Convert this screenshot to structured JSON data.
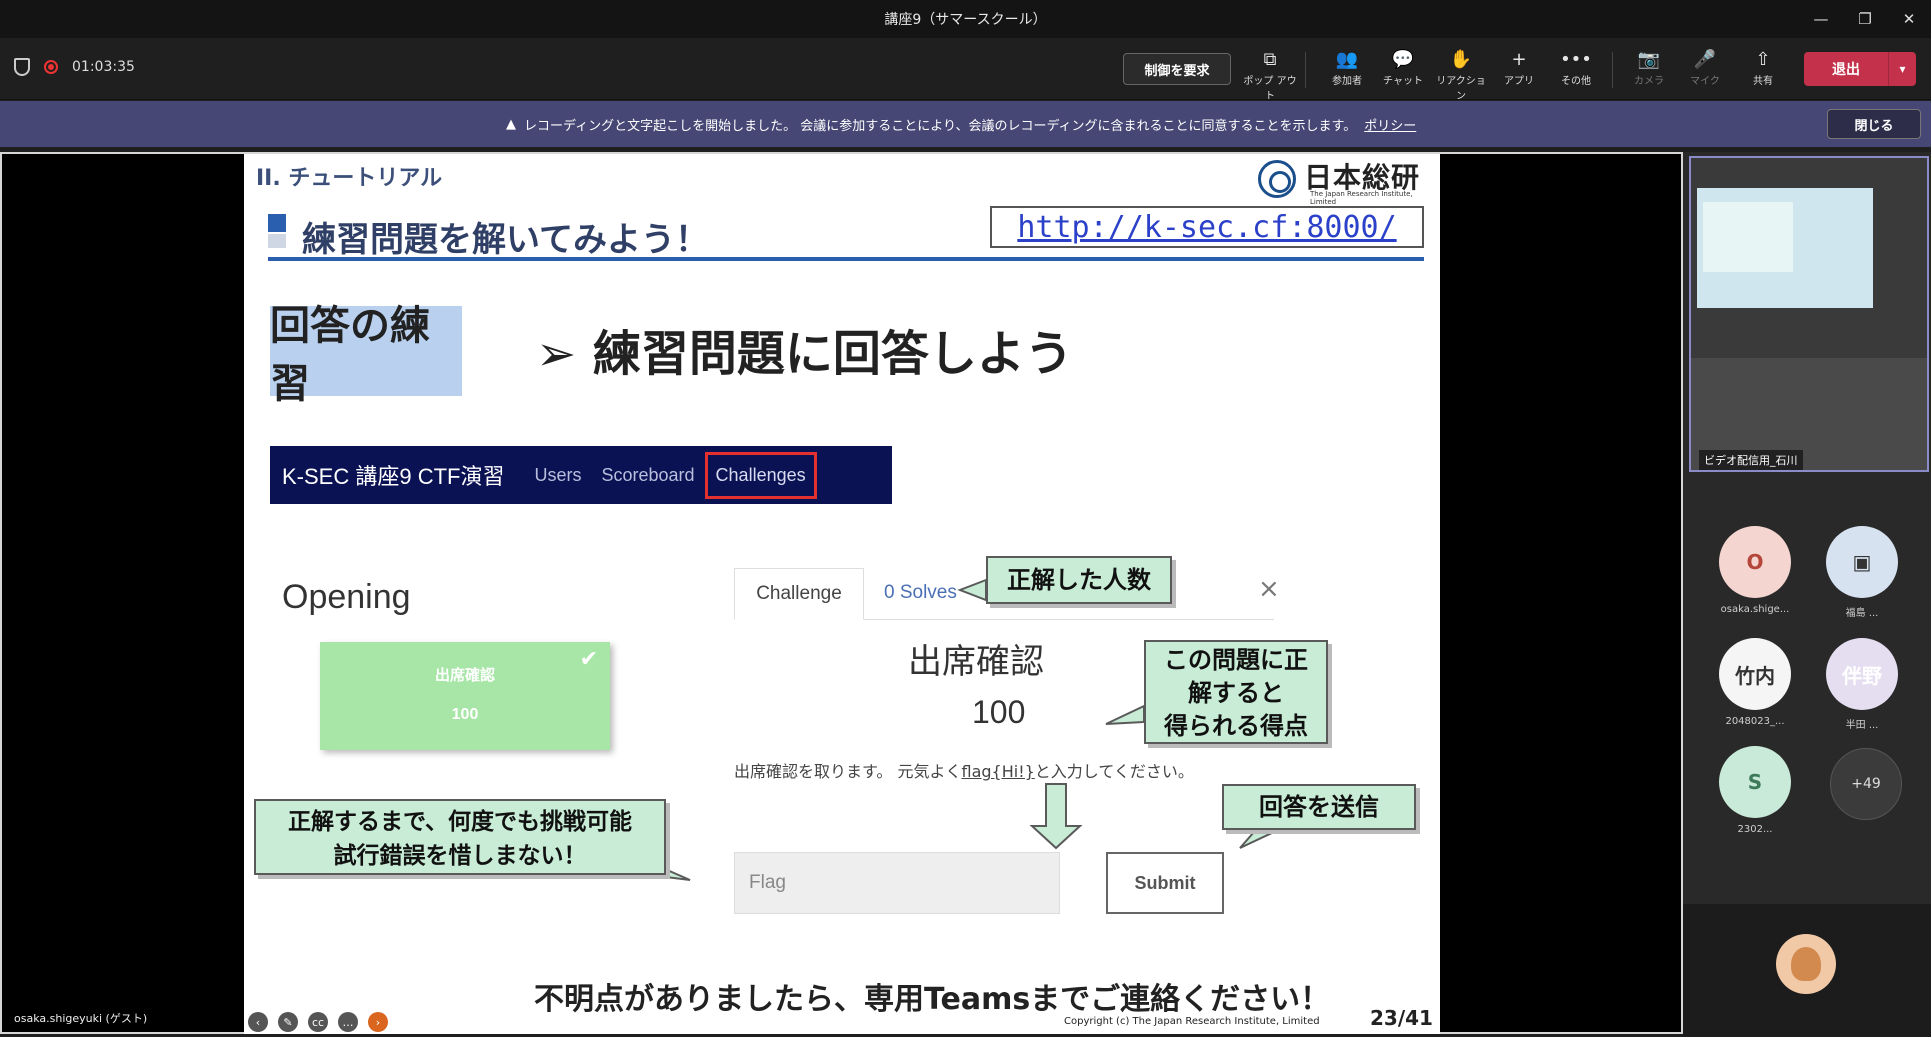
{
  "window": {
    "title": "講座9（サマースクール）",
    "controls": [
      "—",
      "❐",
      "✕"
    ]
  },
  "toolbar": {
    "timer": "01:03:35",
    "request_control": "制御を要求",
    "tools": [
      {
        "label": "ポップ アウト",
        "icon": "popout-icon",
        "glyph": "⧉"
      },
      {
        "label": "参加者",
        "icon": "people-icon",
        "glyph": "👥"
      },
      {
        "label": "チャット",
        "icon": "chat-icon",
        "glyph": "💬"
      },
      {
        "label": "リアクション",
        "icon": "reaction-icon",
        "glyph": "✋"
      },
      {
        "label": "アプリ",
        "icon": "apps-icon",
        "glyph": "+"
      },
      {
        "label": "その他",
        "icon": "more-icon",
        "glyph": "•••"
      },
      {
        "label": "カメラ",
        "icon": "camera-off-icon",
        "glyph": "📷"
      },
      {
        "label": "マイク",
        "icon": "mic-off-icon",
        "glyph": "🎤"
      },
      {
        "label": "共有",
        "icon": "share-icon",
        "glyph": "⇧"
      }
    ],
    "leave": "退出"
  },
  "banner": {
    "message": "レコーディングと文字起こしを開始しました。 会議に参加することにより、会議のレコーディングに含まれることに同意することを示します。",
    "link": "ポリシー",
    "close": "閉じる"
  },
  "slide": {
    "section": "II. チュートリアル",
    "logo_jp": "日本総研",
    "logo_en": "The Japan Research Institute, Limited",
    "heading": "練習問題を解いてみよう！",
    "url": "http://k-sec.cf:8000/",
    "tag": "回答の練習",
    "title": "➢ 練習問題に回答しよう",
    "ctf_nav": {
      "brand": "K-SEC 講座9 CTF演習",
      "items": [
        "Users",
        "Scoreboard",
        "Challenges"
      ]
    },
    "opening": "Opening",
    "card": {
      "name": "出席確認",
      "points": "100",
      "check": "✔"
    },
    "modal": {
      "tab_challenge": "Challenge",
      "tab_solves": "0 Solves",
      "close": "×",
      "name": "出席確認",
      "points": "100",
      "desc_before": "出席確認を取ります。 元気よく",
      "desc_flag": "flag{Hi!}",
      "desc_after": "と入力してください。",
      "placeholder": "Flag",
      "submit": "Submit"
    },
    "callouts": {
      "solves": "正解した人数",
      "points_l1": "この問題に正",
      "points_l2": "解すると",
      "points_l3": "得られる得点",
      "retry_l1": "正解するまで、何度でも挑戦可能",
      "retry_l2": "試行錯誤を惜しまない！",
      "send": "回答を送信"
    },
    "footer": "不明点がありましたら、専用Teamsまでご連絡ください！",
    "copyright": "Copyright (c) The Japan Research Institute, Limited",
    "page": "23/41"
  },
  "presenter_label": "osaka.shigeyuki (ゲスト)",
  "video_label": "ビデオ配信用_石川",
  "participants": [
    {
      "initials": "O",
      "name": "osaka.shige...",
      "bg": "#f4d5d0",
      "fg": "#b5473a"
    },
    {
      "initials": "",
      "name": "福島 ...",
      "bg": "#d6e2f0",
      "fg": "#333"
    },
    {
      "initials": "竹内",
      "name": "2048023_...",
      "bg": "#f5f5f5",
      "fg": "#333"
    },
    {
      "initials": "伴野",
      "name": "半田 ...",
      "bg": "#e4def0",
      "fg": "#fff"
    },
    {
      "initials": "S",
      "name": "2302...",
      "bg": "#c9ead9",
      "fg": "#3d7a5a"
    }
  ],
  "more_count": "+49"
}
